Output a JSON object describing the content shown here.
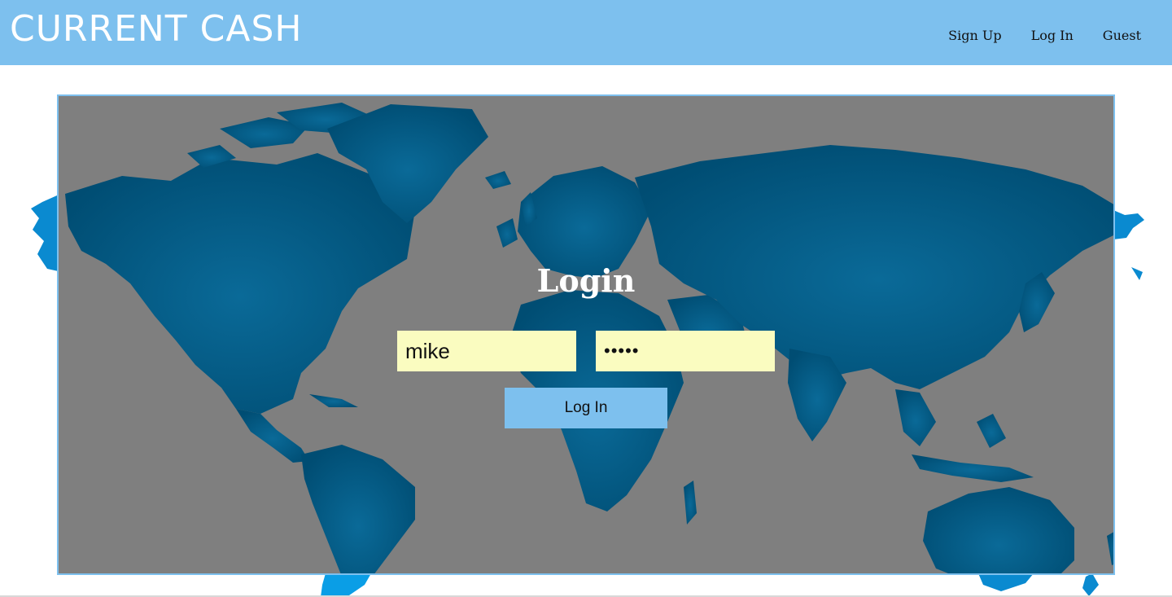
{
  "header": {
    "brand": "CURRENT CASH",
    "nav": [
      {
        "label": "Sign Up"
      },
      {
        "label": "Log In"
      },
      {
        "label": "Guest"
      }
    ]
  },
  "login": {
    "title": "Login",
    "username_value": "mike",
    "password_value": "•••••",
    "submit_label": "Log In"
  },
  "colors": {
    "header_bg": "#7dc0ee",
    "map_land": "#005a85",
    "map_bg": "#7f7f7f",
    "field_bg": "#fafcc0",
    "button_bg": "#7dc0ee"
  }
}
